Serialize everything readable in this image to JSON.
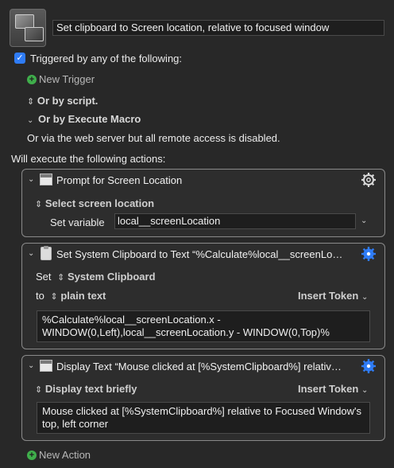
{
  "macro": {
    "title": "Set clipboard to Screen location, relative to focused window"
  },
  "triggers": {
    "checkbox_label": "Triggered by any of the following:",
    "new_trigger": "New Trigger",
    "or_by_script": "Or by script.",
    "or_by_execute_macro": "Or by Execute Macro",
    "web_server_note": "Or via the web server but all remote access is disabled."
  },
  "actions_header": "Will execute the following actions:",
  "actions": [
    {
      "title": "Prompt for Screen Location",
      "option": "Select screen location",
      "set_variable_label": "Set variable",
      "variable_value": "local__screenLocation"
    },
    {
      "title": "Set System Clipboard to Text “%Calculate%local__screenLo…",
      "set_label": "Set",
      "set_value": "System Clipboard",
      "to_label": "to",
      "to_value": "plain text",
      "insert_token": "Insert Token",
      "text_line1": "%Calculate%local__screenLocation.x -",
      "text_line2": "WINDOW(0,Left),local__screenLocation.y - WINDOW(0,Top)%"
    },
    {
      "title": "Display Text “Mouse clicked at [%SystemClipboard%] relativ…",
      "option": "Display text briefly",
      "insert_token": "Insert Token",
      "text_line1": "Mouse clicked at [%SystemClipboard%] relative to Focused Window's",
      "text_line2": "top, left corner"
    }
  ],
  "new_action": "New Action",
  "colors": {
    "background": "#282828",
    "accent": "#2f7cf6",
    "add_green": "#3fae4b"
  }
}
